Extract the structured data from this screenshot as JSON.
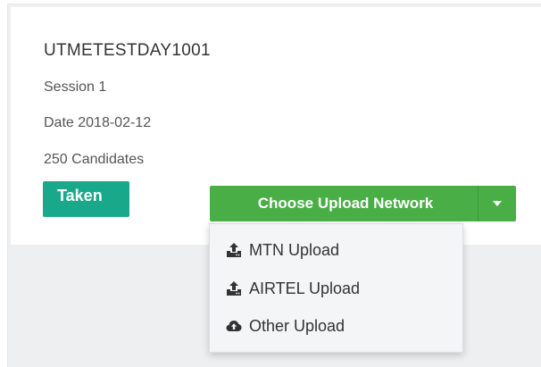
{
  "exam": {
    "id": "UTMETESTDAY1001",
    "session": "Session 1",
    "date": "Date 2018-02-12",
    "candidates": "250 Candidates"
  },
  "status": {
    "label": "Taken",
    "color": "#1aa88a"
  },
  "upload_button": {
    "label": "Choose Upload Network",
    "color": "#4aae47",
    "caret_icon": "caret-down-icon"
  },
  "dropdown": {
    "items": [
      {
        "label": "MTN Upload",
        "icon": "upload-icon"
      },
      {
        "label": "AIRTEL Upload",
        "icon": "upload-icon"
      },
      {
        "label": "Other Upload",
        "icon": "cloud-upload-icon"
      }
    ]
  }
}
